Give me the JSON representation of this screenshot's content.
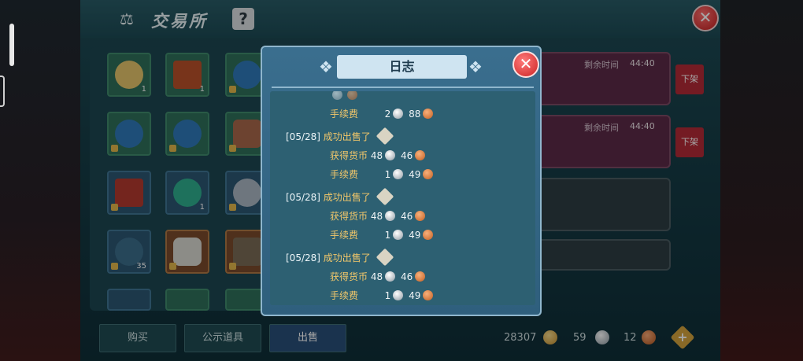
{
  "header": {
    "title": "交易所",
    "help": "?",
    "close": "✕"
  },
  "inventory": {
    "slots": [
      {
        "count": "1"
      },
      {
        "count": "1"
      },
      {
        "count": ""
      },
      {
        "count": ""
      },
      {
        "count": ""
      },
      {
        "count": ""
      },
      {
        "count": ""
      },
      {
        "count": "1"
      },
      {
        "count": ""
      },
      {
        "count": "35"
      },
      {
        "count": ""
      },
      {
        "count": ""
      }
    ]
  },
  "listings": [
    {
      "label": "剩余时间",
      "time": "44:40",
      "delist": "下架"
    },
    {
      "label": "剩余时间",
      "time": "44:40",
      "delist": "下架"
    }
  ],
  "tabs": [
    "购买",
    "公示道具",
    "出售"
  ],
  "currency": {
    "gold": "28307",
    "silver": "59",
    "copper": "12"
  },
  "log": {
    "title": "日志",
    "entries": [
      {
        "fee_label": "手续费",
        "fee_silver": "2",
        "fee_copper": "88"
      },
      {
        "date": "[05/28]",
        "sold_label": "成功出售了",
        "earn_label": "获得货币",
        "earn_silver": "48",
        "earn_copper": "46",
        "fee_label": "手续费",
        "fee_silver": "1",
        "fee_copper": "49"
      },
      {
        "date": "[05/28]",
        "sold_label": "成功出售了",
        "earn_label": "获得货币",
        "earn_silver": "48",
        "earn_copper": "46",
        "fee_label": "手续费",
        "fee_silver": "1",
        "fee_copper": "49"
      },
      {
        "date": "[05/28]",
        "sold_label": "成功出售了",
        "earn_label": "获得货币",
        "earn_silver": "48",
        "earn_copper": "46",
        "fee_label": "手续费",
        "fee_silver": "1",
        "fee_copper": "49"
      }
    ],
    "close": "✕"
  },
  "colors": {
    "accent_gold": "#f2c76a",
    "item_green": "#2fd14b",
    "close_red": "#cc2323"
  }
}
